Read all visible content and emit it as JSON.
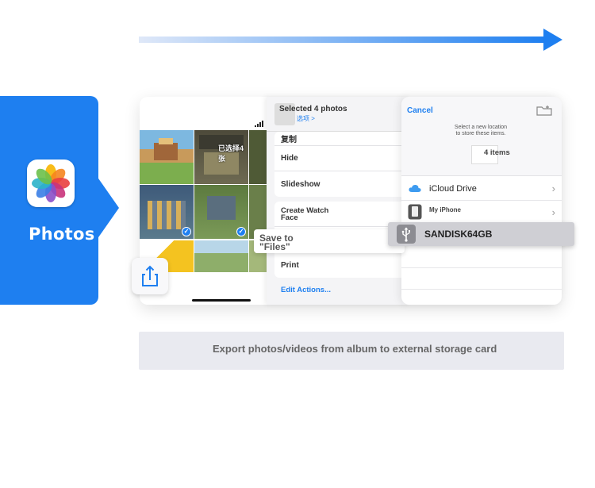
{
  "app": {
    "name": "Photos",
    "icon": "photos-app-icon",
    "accent": "#1e7ff0"
  },
  "share_sheet": {
    "title": "Selected 4 photos",
    "subtitle": "选项 >",
    "items": [
      {
        "label": "复制"
      },
      {
        "label": "Hide"
      },
      {
        "label": "Slideshow"
      },
      {
        "label": "Create Watch\nFace"
      },
      {
        "label": ""
      },
      {
        "label": "Print"
      }
    ],
    "edit_actions": "Edit Actions..."
  },
  "callout": {
    "save_to_files": "Save to\n\"Files\""
  },
  "files_panel": {
    "cancel": "Cancel",
    "prompt": "Select a new location\nto store these items.",
    "items_count": "4 items",
    "locations": [
      {
        "label": "iCloud Drive",
        "icon": "icloud-icon"
      },
      {
        "label": "My iPhone",
        "icon": "iphone-icon"
      }
    ],
    "external": {
      "label": "SANDISK64GB",
      "icon": "usb-icon"
    }
  },
  "thumbnail_text": "已选择4张",
  "caption": "Export photos/videos from album to external storage card"
}
